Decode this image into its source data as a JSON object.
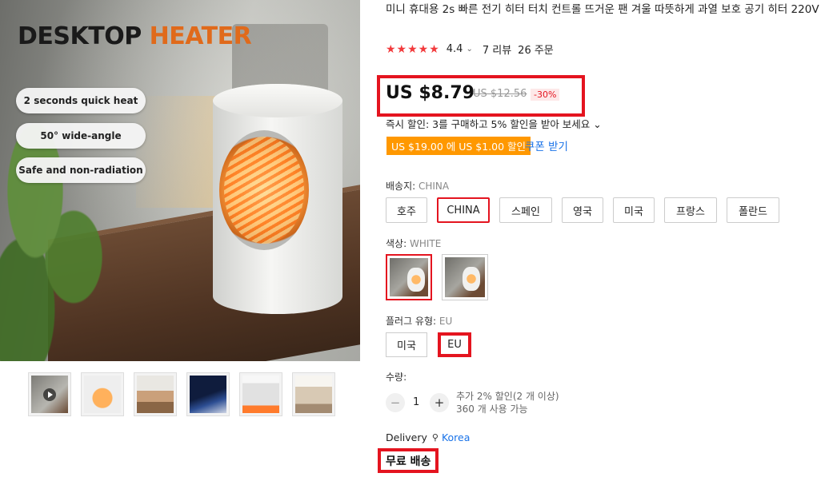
{
  "hero": {
    "title_main": "DESKTOP ",
    "title_accent": "HEATER",
    "features": [
      "2 seconds quick heat",
      "50° wide-angle",
      "Safe and non-radiation"
    ]
  },
  "thumbnails": [
    {
      "name": "thumbnail-1",
      "has_video": true
    },
    {
      "name": "thumbnail-2"
    },
    {
      "name": "thumbnail-3"
    },
    {
      "name": "thumbnail-4"
    },
    {
      "name": "thumbnail-5"
    },
    {
      "name": "thumbnail-6"
    }
  ],
  "product": {
    "title": "미니 휴대용 2s 빠른 전기 히터 터치 컨트롤 뜨거운 팬 겨울 따뜻하게 과열 보호 공기 히터 220V",
    "rating": "4.4",
    "rating_chevron": "⌄",
    "reviews": "7 리뷰",
    "orders": "26 주문",
    "stars": "★★★★★"
  },
  "price": {
    "current": "US $8.79",
    "original": "US $12.56",
    "discount": "-30%"
  },
  "promo": {
    "instant_discount": "즉시 할인: 3를 구매하고 5% 할인을 받아 보세요",
    "instant_chevron": "⌄",
    "coupon_badge": "US $19.00 에 US $1.00 할인",
    "coupon_link": "쿠폰 받기"
  },
  "ship_from": {
    "label": "배송지: ",
    "value": "CHINA",
    "options": [
      "호주",
      "CHINA",
      "스페인",
      "영국",
      "미국",
      "프랑스",
      "폴란드"
    ],
    "selected": "CHINA"
  },
  "color": {
    "label": "색상: ",
    "value": "WHITE"
  },
  "plug": {
    "label": "플러그 유형: ",
    "value": "EU",
    "options": [
      "미국",
      "EU"
    ],
    "selected": "EU"
  },
  "quantity": {
    "label": "수량:",
    "minus": "−",
    "plus": "+",
    "value": "1",
    "note_line1": "추가 2% 할인(2 개 이상)",
    "note_line2": "360 개 사용 가능"
  },
  "delivery": {
    "label": "Delivery",
    "pin": "⚲",
    "location": "Korea"
  },
  "shipping": {
    "free": "무료 배송"
  },
  "colors": {
    "accent_red": "#e4141f",
    "coupon_orange": "#ff9800",
    "link_blue": "#1a73e8",
    "star_red": "#f23a3c"
  }
}
